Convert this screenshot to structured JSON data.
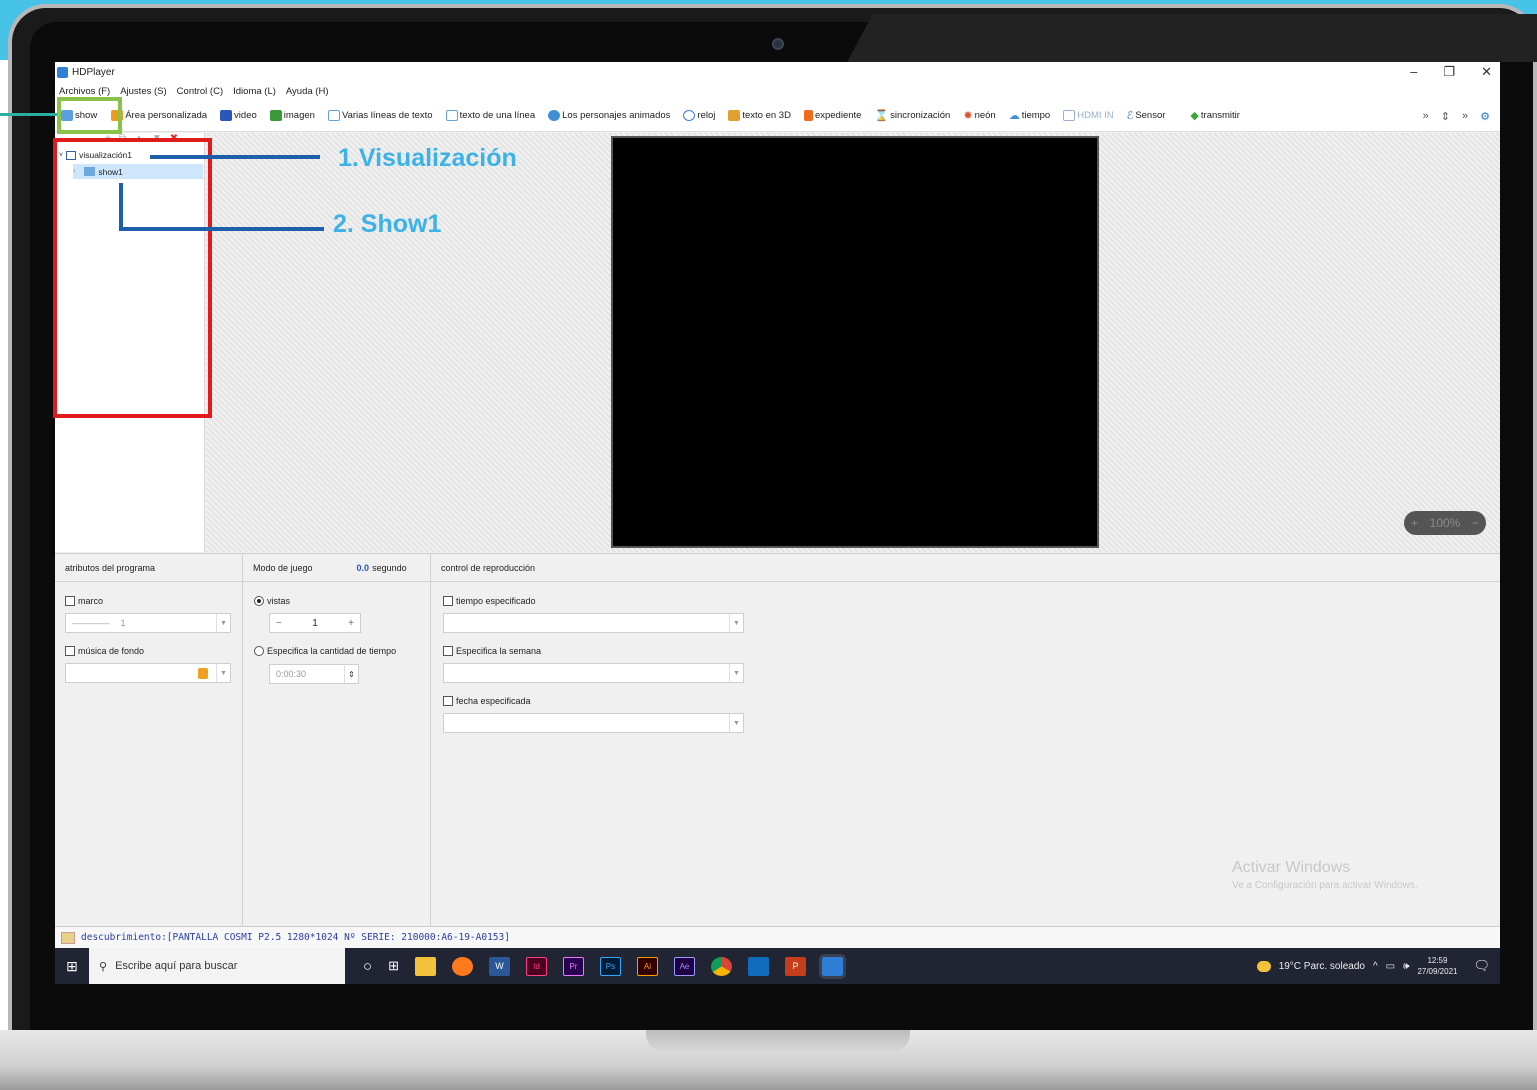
{
  "app": {
    "title": "HDPlayer",
    "window_controls": [
      "–",
      "❐",
      "✕"
    ]
  },
  "menu": [
    "Archivos (F)",
    "Ajustes (S)",
    "Control (C)",
    "Idioma (L)",
    "Ayuda (H)"
  ],
  "toolbar": {
    "items": [
      {
        "label": "show",
        "icon": "show-icon",
        "color": "#5aa0e0"
      },
      {
        "label": "Área personalizada",
        "icon": "custom-area-icon",
        "color": "#f29a1c"
      },
      {
        "label": "video",
        "icon": "video-icon",
        "color": "#2a57b8"
      },
      {
        "label": "imagen",
        "icon": "image-icon",
        "color": "#3a9a3a"
      },
      {
        "label": "Varias líneas de texto",
        "icon": "multiline-text-icon",
        "color": "#6aa0d8"
      },
      {
        "label": "texto de una línea",
        "icon": "single-line-text-icon",
        "color": "#6aa0d8"
      },
      {
        "label": "Los personajes animados",
        "icon": "animated-characters-icon",
        "color": "#3e8fd6"
      },
      {
        "label": "reloj",
        "icon": "clock-icon",
        "color": "#3e7fd6"
      },
      {
        "label": "texto en 3D",
        "icon": "3d-text-icon",
        "color": "#e0a030"
      },
      {
        "label": "expediente",
        "icon": "document-icon",
        "color": "#f06a1c"
      },
      {
        "label": "sincronización",
        "icon": "hourglass-icon",
        "color": "#3e6fb6"
      },
      {
        "label": "neón",
        "icon": "neon-icon",
        "color": "#e05030"
      },
      {
        "label": "tiempo",
        "icon": "weather-icon",
        "color": "#3e8fd6"
      },
      {
        "label": "HDMI IN",
        "icon": "hdmi-icon",
        "color": "#9ab0c8"
      },
      {
        "label": "Sensor",
        "icon": "sensor-icon",
        "color": "#3e6fb6"
      },
      {
        "label": "transmitir",
        "icon": "transmit-icon",
        "color": "#3aa83a"
      }
    ],
    "overflow": "»",
    "up_down": "⇕",
    "overflow2": "»",
    "settings": "⚙"
  },
  "tree": {
    "tools": [
      "+",
      "⧉",
      "▲",
      "▼",
      "✖"
    ],
    "root": "visualización1",
    "child": "show1"
  },
  "canvas": {
    "zoom_plus": "+",
    "zoom_value": "100%",
    "zoom_minus": "−"
  },
  "props": {
    "col1_title": "atributos del programa",
    "col2_title": "Modo de juego",
    "col2_value": "0.0",
    "col2_unit": "segundo",
    "col3_title": "control de reproducción",
    "marco_label": "marco",
    "marco_value": "1",
    "musica_label": "música de fondo",
    "vistas_label": "vistas",
    "vistas_value": "1",
    "especifica_tiempo_label": "Especifica la cantidad de tiempo",
    "tiempo_value": "0:00:30",
    "tiempo_especificado_label": "tiempo especificado",
    "semana_label": "Especifica la semana",
    "fecha_label": "fecha especificada"
  },
  "watermark": {
    "title": "Activar Windows",
    "sub": "Ve a Configuración para activar Windows."
  },
  "status": "descubrimiento:[PANTALLA COSMI P2.5 1280*1024 Nº SERIE: 210000:A6-19-A0153]",
  "taskbar": {
    "search_placeholder": "Escribe aquí para buscar",
    "apps": [
      {
        "name": "cortana",
        "color": "#202433",
        "glyph": "○"
      },
      {
        "name": "task-view",
        "color": "#202433",
        "glyph": "⊞"
      },
      {
        "name": "explorer",
        "color": "#f2c23a",
        "glyph": ""
      },
      {
        "name": "firefox",
        "color": "#ff7a1c",
        "glyph": ""
      },
      {
        "name": "word",
        "color": "#2b5797",
        "glyph": "W"
      },
      {
        "name": "indesign",
        "color": "#49021f",
        "glyph": "Id"
      },
      {
        "name": "premiere",
        "color": "#2a0050",
        "glyph": "Pr"
      },
      {
        "name": "photoshop",
        "color": "#001d34",
        "glyph": "Ps"
      },
      {
        "name": "illustrator",
        "color": "#330000",
        "glyph": "Ai"
      },
      {
        "name": "aftereffects",
        "color": "#1f0040",
        "glyph": "Ae"
      },
      {
        "name": "chrome",
        "color": "#e0a020",
        "glyph": ""
      },
      {
        "name": "outlook",
        "color": "#0f6cbd",
        "glyph": ""
      },
      {
        "name": "powerpoint",
        "color": "#c43e1c",
        "glyph": "P"
      },
      {
        "name": "hdplayer",
        "color": "#2f7fd7",
        "glyph": ""
      }
    ],
    "weather": "19°C  Parc. soleado",
    "time": "12:59",
    "date": "27/09/2021"
  },
  "annotations": {
    "label1": "1.Visualización",
    "label2": "2. Show1",
    "colors": {
      "green": "#8bc34a",
      "red": "#e01b1b",
      "text": "#3db2e8",
      "line": "#1d5fa8"
    }
  }
}
